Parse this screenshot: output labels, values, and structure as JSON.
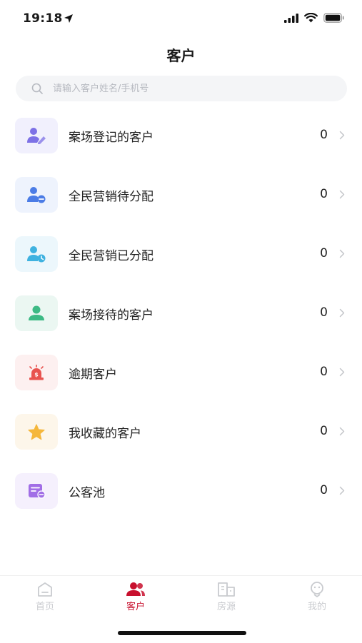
{
  "status_bar": {
    "time": "19:18"
  },
  "header": {
    "title": "客户"
  },
  "search": {
    "placeholder": "请输入客户姓名/手机号"
  },
  "list": {
    "items": [
      {
        "label": "案场登记的客户",
        "count": "0",
        "icon": "user-edit-icon",
        "bg": "#f1f0fd",
        "color": "#7d71e6"
      },
      {
        "label": "全民营销待分配",
        "count": "0",
        "icon": "user-pending-icon",
        "bg": "#eef3fd",
        "color": "#4b7ce6"
      },
      {
        "label": "全民营销已分配",
        "count": "0",
        "icon": "user-assigned-icon",
        "bg": "#ecf7fc",
        "color": "#3fb2e0"
      },
      {
        "label": "案场接待的客户",
        "count": "0",
        "icon": "user-reception-icon",
        "bg": "#ebf7f2",
        "color": "#3dba85"
      },
      {
        "label": "逾期客户",
        "count": "0",
        "icon": "alarm-icon",
        "bg": "#fdf0f0",
        "color": "#e8534f"
      },
      {
        "label": "我收藏的客户",
        "count": "0",
        "icon": "star-icon",
        "bg": "#fdf6ea",
        "color": "#f5b73c"
      },
      {
        "label": "公客池",
        "count": "0",
        "icon": "pool-card-icon",
        "bg": "#f5f0fd",
        "color": "#a16ee6"
      }
    ]
  },
  "tabbar": {
    "tabs": [
      {
        "label": "首页",
        "icon": "home-icon"
      },
      {
        "label": "客户",
        "icon": "customers-icon",
        "active": true
      },
      {
        "label": "房源",
        "icon": "building-icon"
      },
      {
        "label": "我的",
        "icon": "profile-icon"
      }
    ]
  },
  "colors": {
    "accent": "#c8102e",
    "inactive_tab": "#c9cbcf"
  }
}
